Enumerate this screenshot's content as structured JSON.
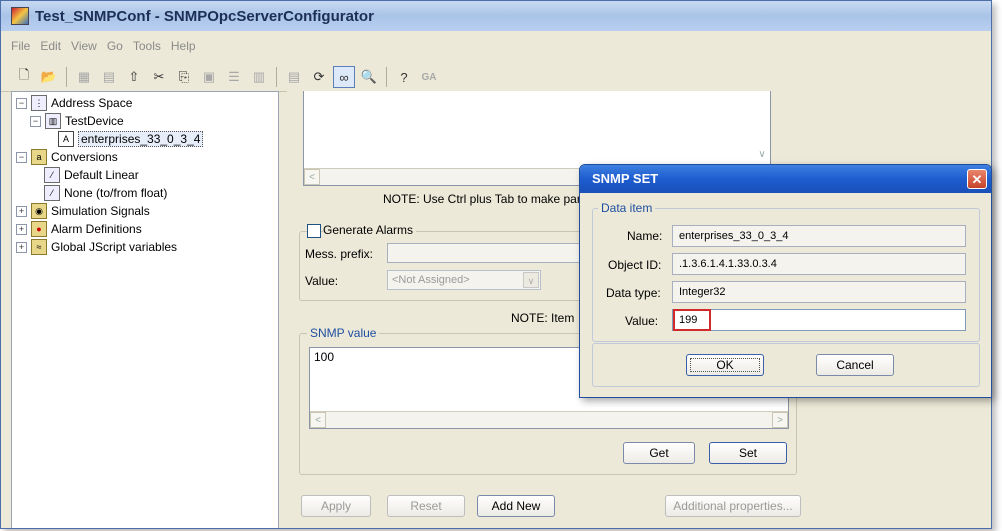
{
  "window": {
    "title": "Test_SNMPConf - SNMPOpcServerConfigurator"
  },
  "menu": [
    "File",
    "Edit",
    "View",
    "Go",
    "Tools",
    "Help"
  ],
  "toolbar": {
    "ga_label": "GA"
  },
  "tree": {
    "address_space": "Address Space",
    "test_device": "TestDevice",
    "item": "enterprises_33_0_3_4",
    "conversions": "Conversions",
    "default_linear": "Default Linear",
    "none_float": "None (to/from float)",
    "simulation_signals": "Simulation Signals",
    "alarm_definitions": "Alarm Definitions",
    "global_jscript": "Global JScript variables"
  },
  "panel": {
    "note_ctrl_tab": "NOTE: Use Ctrl plus Tab to make par",
    "generate_alarms": "Generate Alarms",
    "mess_prefix": "Mess. prefix:",
    "value_label": "Value:",
    "value_combo": "<Not Assigned>",
    "note_item": "NOTE: Item",
    "snmp_value_legend": "SNMP value",
    "snmp_value": "100",
    "get_button": "Get",
    "set_button": "Set",
    "apply_button": "Apply",
    "reset_button": "Reset",
    "add_new_button": "Add New",
    "additional_properties_button": "Additional properties..."
  },
  "dialog": {
    "title": "SNMP SET",
    "group_legend": "Data item",
    "name_label": "Name:",
    "name_value": "enterprises_33_0_3_4",
    "object_id_label": "Object ID:",
    "object_id_value": ".1.3.6.1.4.1.33.0.3.4",
    "data_type_label": "Data type:",
    "data_type_value": "Integer32",
    "value_label": "Value:",
    "value_value": "199",
    "ok_button": "OK",
    "cancel_button": "Cancel"
  }
}
